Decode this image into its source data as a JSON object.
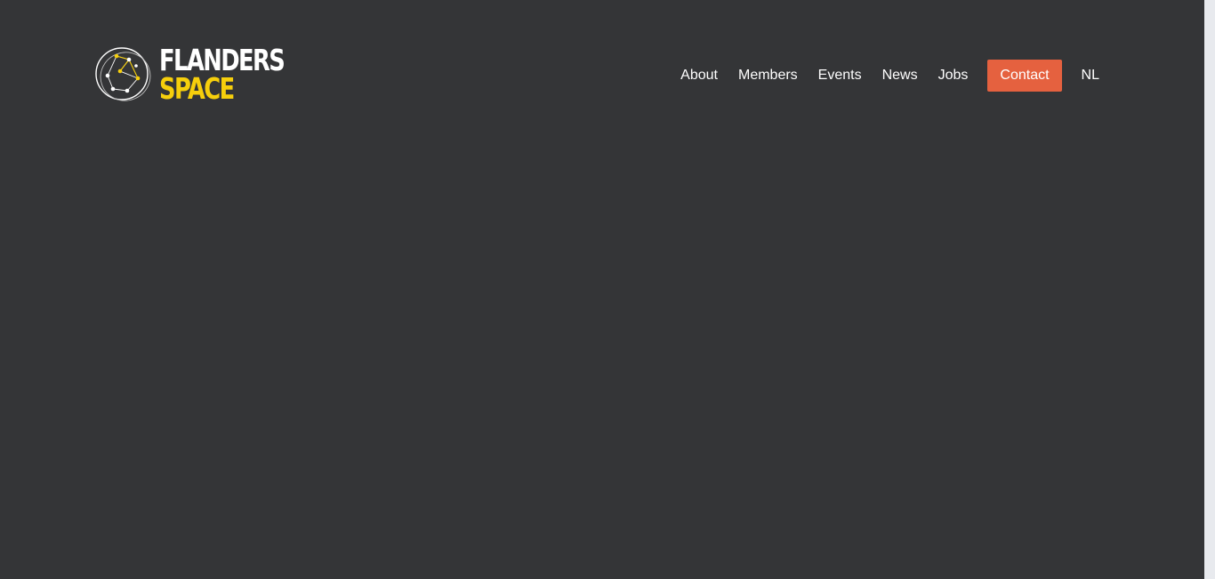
{
  "brand": {
    "line1": "FLANDERS",
    "line2": "SPACE",
    "logo_icon": "constellation-logo-icon",
    "colors": {
      "line1": "#ffffff",
      "line2": "#f6cf0c"
    }
  },
  "nav": {
    "items": [
      {
        "label": "About"
      },
      {
        "label": "Members"
      },
      {
        "label": "Events"
      },
      {
        "label": "News"
      },
      {
        "label": "Jobs"
      }
    ],
    "contact_label": "Contact",
    "language_label": "NL"
  },
  "colors": {
    "background": "#343537",
    "accent": "#e5613f",
    "scrollbar": "#e8eaee"
  }
}
